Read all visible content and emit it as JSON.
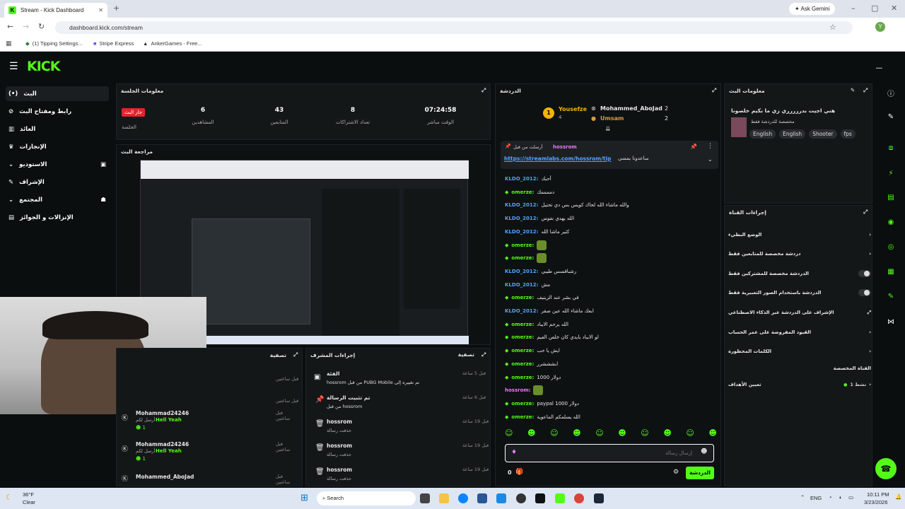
{
  "browser": {
    "tab_title": "Stream - Kick Dashboard",
    "url": "dashboard.kick.com/stream",
    "bookmarks": [
      "(1) Tipping Settings...",
      "Stripe Express",
      "AnkerGames - Free..."
    ],
    "ask_gemini": "Ask Gemini",
    "profile_initial": "Y"
  },
  "kick": {
    "logo": "KICK"
  },
  "sidebar": {
    "items": [
      {
        "label": "البث"
      },
      {
        "label": "رابط ومفتاح البث"
      },
      {
        "label": "العائد"
      },
      {
        "label": "الإنجازات"
      },
      {
        "label": "الاستوديو"
      },
      {
        "label": "الإشراف"
      },
      {
        "label": "المجتمع"
      },
      {
        "label": "الإنزالات و الجوائز"
      }
    ]
  },
  "session": {
    "title": "معلومات الجلسة",
    "live_badge": "جار البث",
    "session_label": "الجلسة",
    "stats": [
      {
        "value": "6",
        "label": "المشاهدين"
      },
      {
        "value": "43",
        "label": "المتابعين"
      },
      {
        "value": "8",
        "label": "تعداد الاشتراكات"
      },
      {
        "value": "07:24:58",
        "label": "الوقت مباشر"
      }
    ]
  },
  "preview": {
    "title": "مراجعة البث"
  },
  "chatlog": {
    "title": "تصفية",
    "rows": [
      {
        "time": "قبل ساعتين",
        "user": "",
        "msg": ""
      },
      {
        "time": "قبل ساعتين",
        "user": "Mohammad24246",
        "sub": "أرسل لكم",
        "msg": "Hell Yeah",
        "count": "1"
      },
      {
        "time": "قبل ساعتين",
        "user": "Mohammad24246",
        "sub": "أرسل لكم",
        "msg": "Hell Yeah",
        "count": "1"
      },
      {
        "time": "قبل ساعتين",
        "user": "Mohammed_AboJad"
      }
    ]
  },
  "modlog": {
    "title": "إجراءات المشرف",
    "filter": "تصفية",
    "rows": [
      {
        "time": "قبل 5 ساعة",
        "title": "الفئة",
        "desc": "hossrom من قبل PUBG Mobile تم تغييره إلى"
      },
      {
        "time": "قبل 6 ساعة",
        "title": "تم تثبيت الرسالة",
        "desc": "من قبل hossrom"
      },
      {
        "time": "قبل 19 ساعة",
        "title": "hossrom",
        "desc": "حذفت رسالة"
      },
      {
        "time": "قبل 19 ساعة",
        "title": "hossrom",
        "desc": "حذفت رسالة"
      },
      {
        "time": "قبل 19 ساعة",
        "title": "hossrom",
        "desc": "حذفت رسالة"
      }
    ]
  },
  "chat": {
    "title": "الدردشة",
    "top_gifters": [
      {
        "rank": "1",
        "name": "Yousefze",
        "count": "4"
      },
      {
        "name": "Mohammed_AboJad",
        "count": "2"
      },
      {
        "name": "Umsam",
        "count": "2"
      }
    ],
    "pinned": {
      "by": "أرسلت من قبل",
      "user": "hossrom",
      "link": "https://streamlabs.com/hossrom/tip",
      "text": "ساعدونا يمسي"
    },
    "messages": [
      {
        "user": "KLDO_2012:",
        "text": "أحبك",
        "color": "#4fa3ff"
      },
      {
        "user": "omerze:",
        "text": "دممممك",
        "color": "#53fc18",
        "badge": true
      },
      {
        "user": "KLDO_2012:",
        "text": "والله ماشاء الله لحاك كويس بس دي تحتيل",
        "color": "#4fa3ff"
      },
      {
        "user": "KLDO_2012:",
        "text": "الله يهدي نفوس",
        "color": "#4fa3ff"
      },
      {
        "user": "KLDO_2012:",
        "text": "كثير ماشا الله",
        "color": "#4fa3ff"
      },
      {
        "user": "omerze:",
        "text": "",
        "color": "#53fc18",
        "badge": true,
        "emote": true
      },
      {
        "user": "omerze:",
        "text": "",
        "color": "#53fc18",
        "badge": true,
        "emote": true
      },
      {
        "user": "KLDO_2012:",
        "text": "رشباقسس طيبي",
        "color": "#4fa3ff"
      },
      {
        "user": "KLDO_2012:",
        "text": "مش",
        "color": "#4fa3ff"
      },
      {
        "user": "omerze:",
        "text": "في بشر عند الزيتيف",
        "color": "#53fc18",
        "badge": true
      },
      {
        "user": "KLDO_2012:",
        "text": "ابعك ماشاء الله عين صقر",
        "color": "#4fa3ff"
      },
      {
        "user": "omerze:",
        "text": "الله يرحم الايباد",
        "color": "#53fc18",
        "badge": true
      },
      {
        "user": "omerze:",
        "text": "لو الايباد بايدي كان خلص الفيم",
        "color": "#53fc18",
        "badge": true
      },
      {
        "user": "omerze:",
        "text": "ايش يا حب",
        "color": "#53fc18",
        "badge": true
      },
      {
        "user": "omerze:",
        "text": "ابشششرر",
        "color": "#53fc18",
        "badge": true
      },
      {
        "user": "omerze:",
        "text": "دولار 1000",
        "color": "#53fc18",
        "badge": true
      },
      {
        "user": "hossrom:",
        "text": "",
        "color": "#e879f9",
        "badge": false,
        "emote": true
      },
      {
        "user": "omerze:",
        "text": "paypal دولار 1000",
        "color": "#53fc18",
        "badge": true
      },
      {
        "user": "omerze:",
        "text": "الله يسلمكم الماعوية",
        "color": "#53fc18",
        "badge": true
      }
    ],
    "input_placeholder": "إرسال رسالة",
    "send_label": "الدردشة",
    "count": "0"
  },
  "stream_info": {
    "title": "معلومات البث",
    "stream_title": "هني اجيت بدررررري زي ما بكيم خلصونا",
    "subtitle": "مخصصة للدردشة فقط",
    "tags": [
      "English",
      "English",
      "Shooter",
      "fps"
    ]
  },
  "channel_actions": {
    "title": "إجراءات القناة",
    "items": [
      {
        "label": "الوضع البطيء",
        "kind": "arrow"
      },
      {
        "label": "دردشة مخصصة للمتابعين فقط",
        "kind": "arrow"
      },
      {
        "label": "الدردشة مخصصة للمشتركين فقط",
        "kind": "toggle"
      },
      {
        "label": "الدردشة باستخدام الصور التعبيرية فقط",
        "kind": "toggle"
      },
      {
        "label": "الإشراف على الدردشة عبر الذكاء الاصطناعي",
        "kind": "external"
      },
      {
        "label": "القيود المفروضة على عمر الحساب",
        "kind": "arrow"
      },
      {
        "label": "الكلمات المحظورة",
        "kind": "arrow"
      },
      {
        "label": "القناة المخصصة",
        "kind": "none"
      },
      {
        "label": "تعيين الأهداف",
        "kind": "arrow",
        "extra": "1 نشط"
      }
    ]
  },
  "taskbar": {
    "weather_temp": "36°F",
    "weather_desc": "Clear",
    "search": "Search",
    "lang": "ENG",
    "time": "10:11 PM",
    "date": "3/23/2026"
  }
}
